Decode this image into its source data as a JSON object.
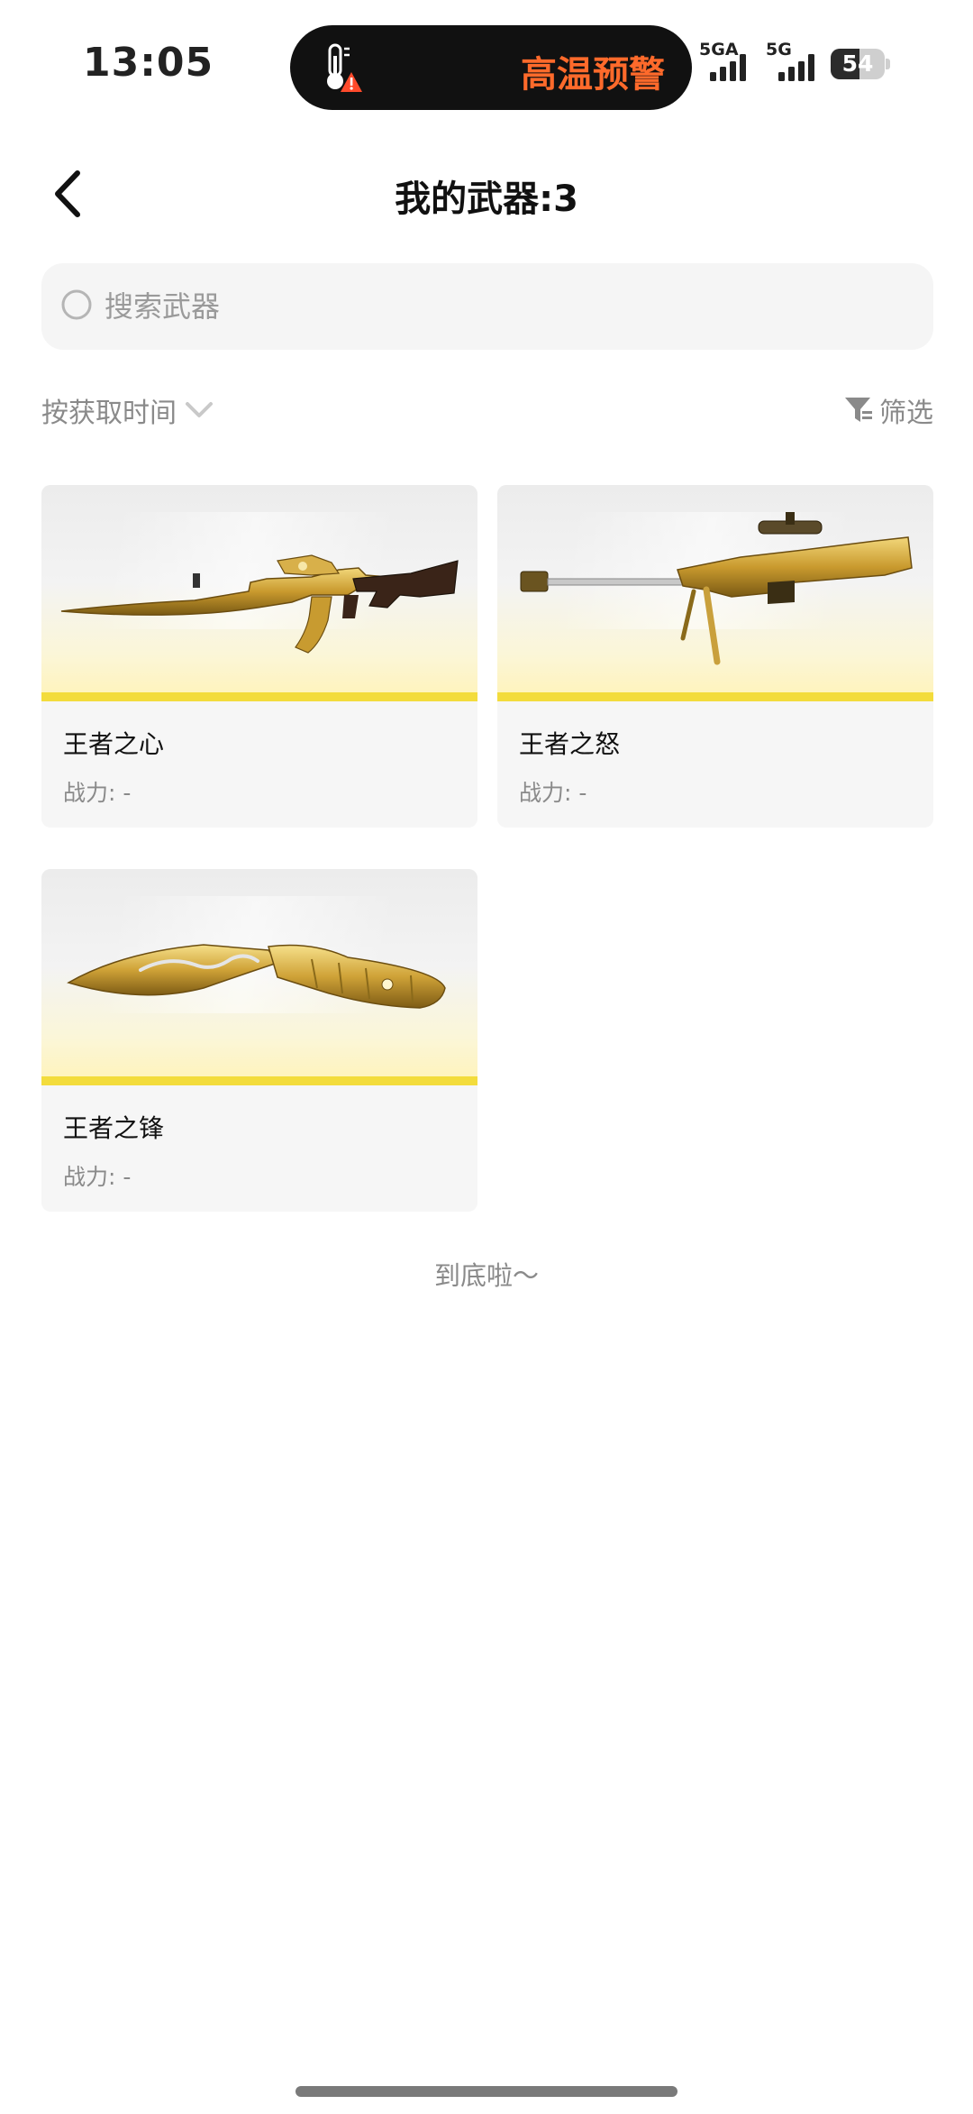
{
  "status_bar": {
    "time": "13:05",
    "alert_text": "高温预警",
    "alert_color": "#ff6a2b",
    "network_1": "5GA",
    "network_2": "5G",
    "battery": "54",
    "battery_level": 0.54
  },
  "header": {
    "title": "我的武器:3"
  },
  "search": {
    "placeholder": "搜索武器",
    "value": ""
  },
  "toolbar": {
    "sort_label": "按获取时间",
    "filter_label": "筛选"
  },
  "weapons": [
    {
      "name": "王者之心",
      "power": "战力: -",
      "icon": "golden-rifle"
    },
    {
      "name": "王者之怒",
      "power": "战力: -",
      "icon": "golden-sniper-rifle"
    },
    {
      "name": "王者之锋",
      "power": "战力: -",
      "icon": "golden-kukri-knife"
    }
  ],
  "list_end_text": "到底啦～",
  "colors": {
    "accent_yellow": "#f3dc3c",
    "card_background": "#f6f6f6",
    "muted_text": "#8a8a8a"
  }
}
